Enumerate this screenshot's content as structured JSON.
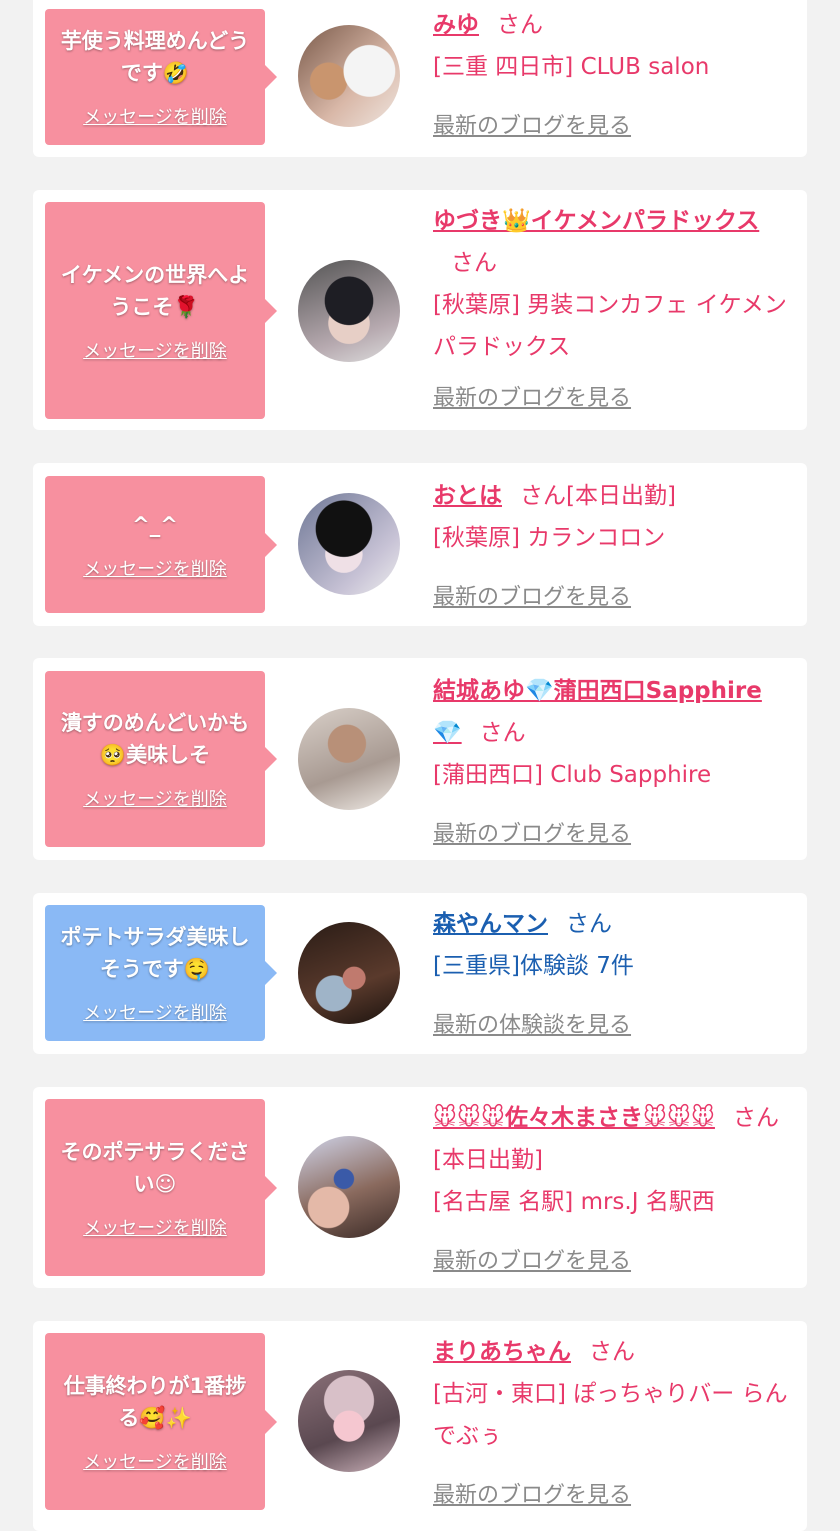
{
  "cards": [
    {
      "bubble_text": "芋使う料理めんどうです🤣",
      "delete_label": "メッセージを削除",
      "name": "みゆ",
      "suffix": "さん",
      "shop": "[三重 四日市] CLUB salon",
      "link": "最新のブログを見る",
      "theme": "pink"
    },
    {
      "bubble_text": "イケメンの世界へようこそ🌹",
      "delete_label": "メッセージを削除",
      "name": "ゆづき👑イケメンパラドックス",
      "suffix": "さん",
      "shop": "[秋葉原] 男装コンカフェ イケメンパラドックス",
      "link": "最新のブログを見る",
      "theme": "pink"
    },
    {
      "bubble_text": "^_^",
      "delete_label": "メッセージを削除",
      "name": "おとは",
      "suffix": "さん[本日出勤]",
      "shop": "[秋葉原] カランコロン",
      "link": "最新のブログを見る",
      "theme": "pink"
    },
    {
      "bubble_text": "潰すのめんどいかも🥺美味しそ",
      "delete_label": "メッセージを削除",
      "name": "結城あゆ💎蒲田西口Sapphire💎",
      "suffix": "さん",
      "shop": "[蒲田西口] Club Sapphire",
      "link": "最新のブログを見る",
      "theme": "pink"
    },
    {
      "bubble_text": "ポテトサラダ美味しそうです🤤",
      "delete_label": "メッセージを削除",
      "name": "森やんマン",
      "suffix": "さん",
      "shop": "[三重県]体験談 7件",
      "link": "最新の体験談を見る",
      "theme": "blue"
    },
    {
      "bubble_text": "そのポテサラください☺",
      "delete_label": "メッセージを削除",
      "name": "🐭🐭🐭佐々木まさき🐭🐭🐭",
      "suffix": "さん[本日出勤]",
      "shop": "[名古屋 名駅] mrs.J 名駅西",
      "link": "最新のブログを見る",
      "theme": "pink"
    },
    {
      "bubble_text": "仕事終わりが1番捗る🥰✨",
      "delete_label": "メッセージを削除",
      "name": "まりあちゃん",
      "suffix": "さん",
      "shop": "[古河・東口] ぽっちゃりバー らんでぶぅ",
      "link": "最新のブログを見る",
      "theme": "pink"
    }
  ],
  "colors": {
    "pink": "#e8396a",
    "blue": "#1b5fb0",
    "bubble_pink": "#f7909f",
    "bubble_blue": "#8ab9f5"
  }
}
